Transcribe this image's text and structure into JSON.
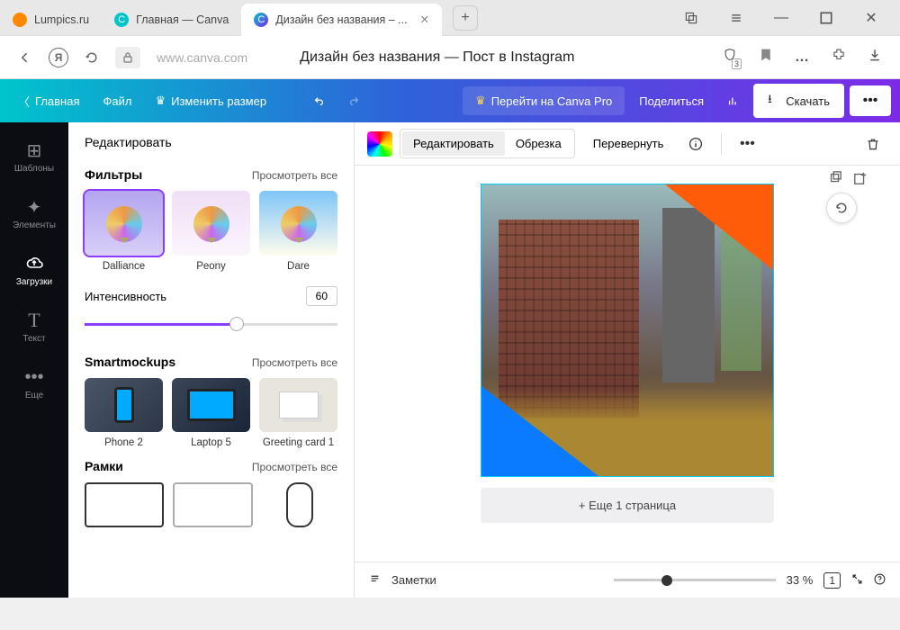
{
  "browser": {
    "tabs": [
      {
        "label": "Lumpics.ru"
      },
      {
        "label": "Главная — Canva"
      },
      {
        "label": "Дизайн без названия – ..."
      }
    ],
    "url_domain": "www.canva.com",
    "page_title": "Дизайн без названия — Пост в Instagram",
    "badge_count": "3"
  },
  "canva_bar": {
    "home": "Главная",
    "file": "Файл",
    "resize": "Изменить размер",
    "pro": "Перейти на Canva Pro",
    "share": "Поделиться",
    "download": "Скачать"
  },
  "rail": {
    "templates": "Шаблоны",
    "elements": "Элементы",
    "uploads": "Загрузки",
    "text": "Текст",
    "more": "Еще"
  },
  "panel": {
    "header": "Редактировать",
    "filters": {
      "title": "Фильтры",
      "see_all": "Просмотреть все",
      "items": [
        "Dalliance",
        "Peony",
        "Dare"
      ]
    },
    "intensity": {
      "label": "Интенсивность",
      "value": "60"
    },
    "smartmockups": {
      "title": "Smartmockups",
      "see_all": "Просмотреть все",
      "items": [
        "Phone 2",
        "Laptop 5",
        "Greeting card 1"
      ]
    },
    "frames": {
      "title": "Рамки",
      "see_all": "Просмотреть все"
    }
  },
  "context": {
    "edit": "Редактировать",
    "crop": "Обрезка",
    "flip": "Перевернуть"
  },
  "canvas": {
    "add_page": "+ Еще 1 страница"
  },
  "zoombar": {
    "notes": "Заметки",
    "zoom": "33 %",
    "pages": "1"
  }
}
